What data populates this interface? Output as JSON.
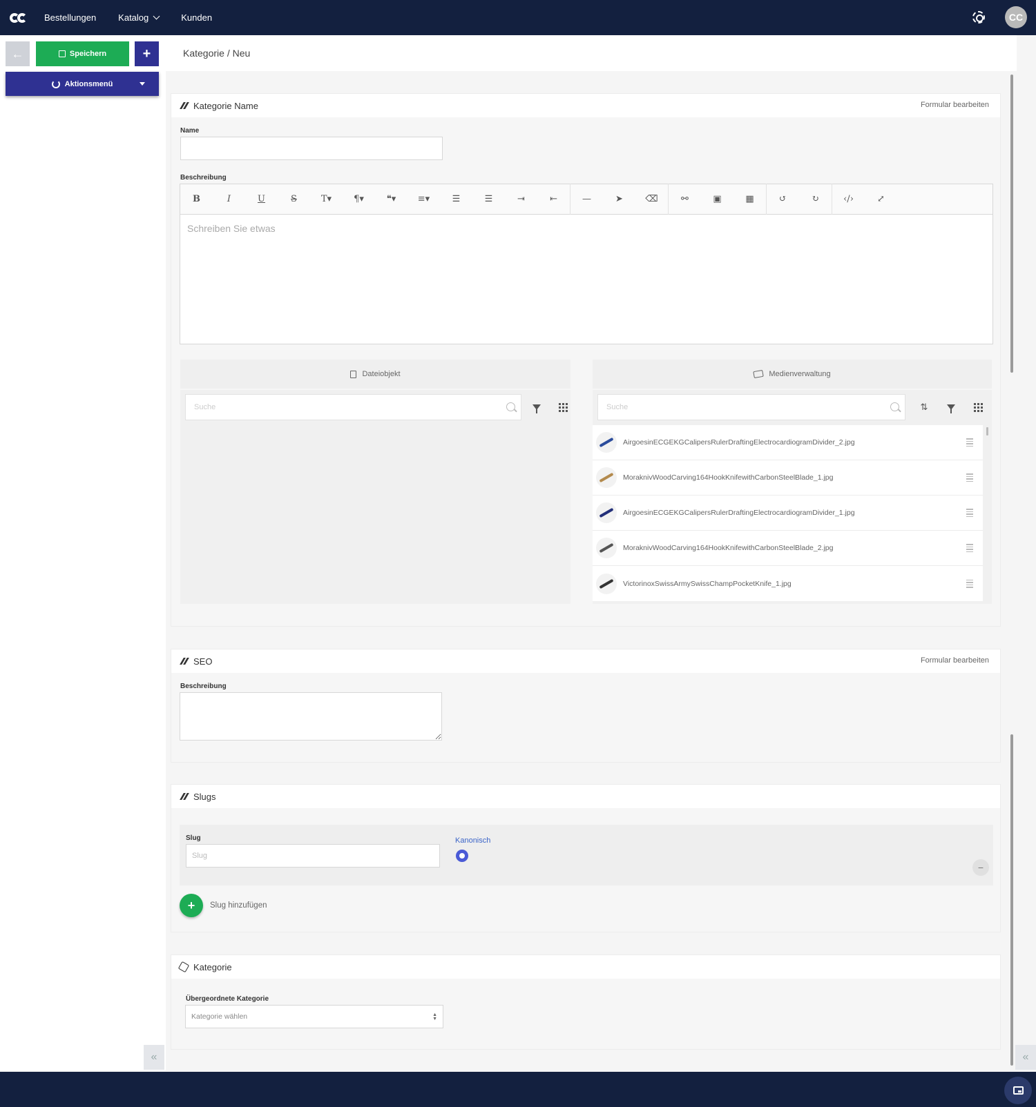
{
  "nav": {
    "items": [
      {
        "label": "Bestellungen"
      },
      {
        "label": "Katalog"
      },
      {
        "label": "Kunden"
      }
    ],
    "avatar_initials": "CC"
  },
  "actions": {
    "save_label": "Speichern",
    "plus_label": "+",
    "menu_label": "Aktionsmenü"
  },
  "breadcrumb": "Kategorie / Neu",
  "name_card": {
    "title": "Kategorie Name",
    "edit_link": "Formular bearbeiten",
    "name_label": "Name",
    "name_value": "",
    "desc_label": "Beschreibung",
    "editor_placeholder": "Schreiben Sie etwas",
    "toolbar": [
      "bold",
      "italic",
      "underline",
      "strikethrough",
      "font-size",
      "paragraph",
      "quote",
      "align",
      "ordered-list",
      "unordered-list",
      "indent",
      "outdent",
      "horizontal-rule",
      "select",
      "eraser",
      "link",
      "image",
      "table",
      "undo",
      "redo",
      "code-view",
      "fullscreen"
    ]
  },
  "file_pane": {
    "title": "Dateiobjekt",
    "search_placeholder": "Suche"
  },
  "media_pane": {
    "title": "Medienverwaltung",
    "search_placeholder": "Suche",
    "files": [
      {
        "name": "AirgoesinECGEKGCalipersRulerDraftingElectrocardiogramDivider_2.jpg",
        "color": "#2b4c9c"
      },
      {
        "name": "MoraknivWoodCarving164HookKnifewithCarbonSteelBlade_1.jpg",
        "color": "#b38a4d"
      },
      {
        "name": "AirgoesinECGEKGCalipersRulerDraftingElectrocardiogramDivider_1.jpg",
        "color": "#23307a"
      },
      {
        "name": "MoraknivWoodCarving164HookKnifewithCarbonSteelBlade_2.jpg",
        "color": "#555555"
      },
      {
        "name": "VictorinoxSwissArmySwissChampPocketKnife_1.jpg",
        "color": "#333333"
      }
    ]
  },
  "seo_card": {
    "title": "SEO",
    "edit_link": "Formular bearbeiten",
    "desc_label": "Beschreibung"
  },
  "slugs_card": {
    "title": "Slugs",
    "slug_label": "Slug",
    "slug_placeholder": "Slug",
    "canonical_label": "Kanonisch",
    "remove_label": "−",
    "add_label": "Slug hinzufügen"
  },
  "category_card": {
    "title": "Kategorie",
    "parent_label": "Übergeordnete Kategorie",
    "parent_placeholder": "Kategorie wählen"
  },
  "collapse_label": "«"
}
